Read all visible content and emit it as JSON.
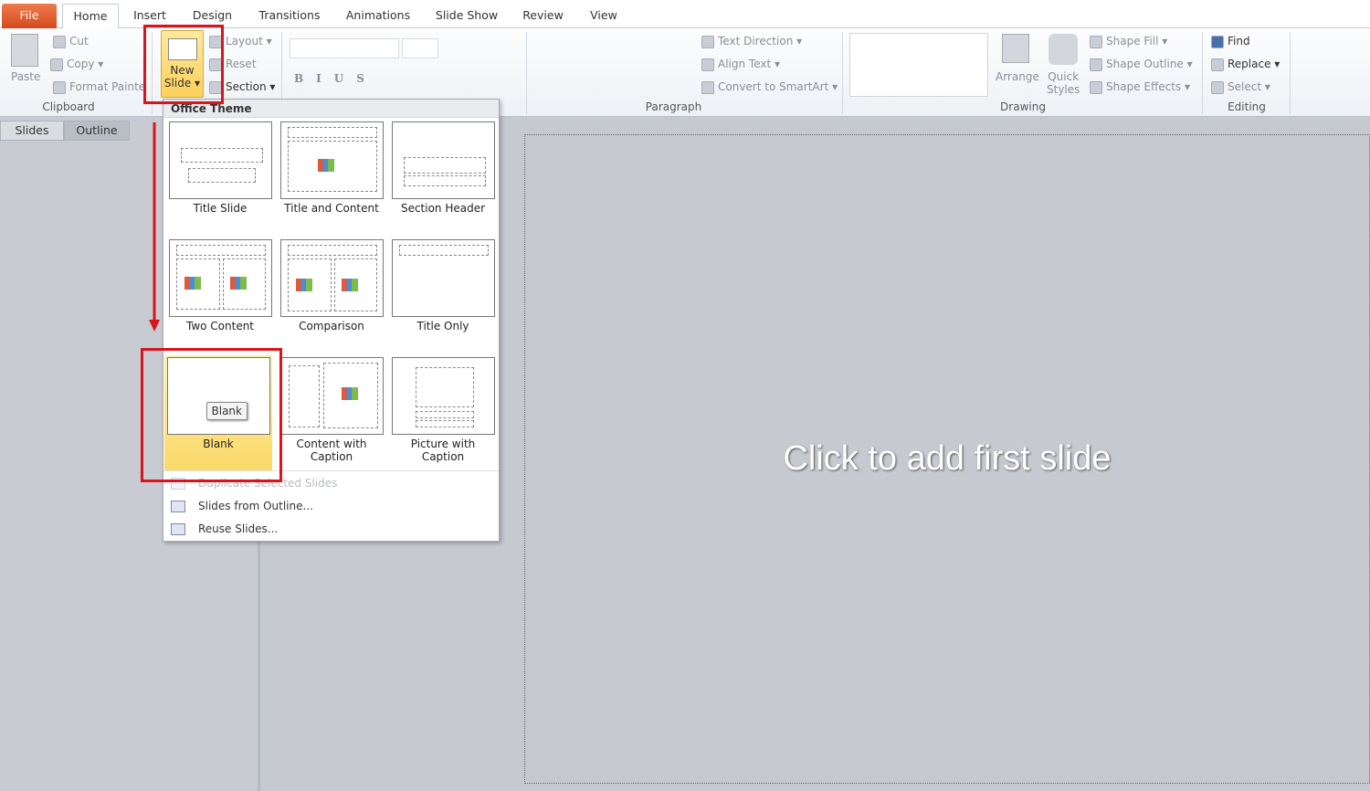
{
  "tabs": [
    {
      "label": "File"
    },
    {
      "label": "Home"
    },
    {
      "label": "Insert"
    },
    {
      "label": "Design"
    },
    {
      "label": "Transitions"
    },
    {
      "label": "Animations"
    },
    {
      "label": "Slide Show"
    },
    {
      "label": "Review"
    },
    {
      "label": "View"
    }
  ],
  "clipboard": {
    "paste": "Paste",
    "cut": "Cut",
    "copy": "Copy",
    "format_painter": "Format Painter",
    "label": "Clipboard"
  },
  "slides": {
    "new_slide_line1": "New",
    "new_slide_line2": "Slide",
    "layout": "Layout",
    "reset": "Reset",
    "section": "Section"
  },
  "paragraph": {
    "text_direction": "Text Direction",
    "align_text": "Align Text",
    "convert_smartart": "Convert to SmartArt",
    "label": "Paragraph"
  },
  "drawing": {
    "arrange": "Arrange",
    "quick_styles_1": "Quick",
    "quick_styles_2": "Styles",
    "shape_fill": "Shape Fill",
    "shape_outline": "Shape Outline",
    "shape_effects": "Shape Effects",
    "label": "Drawing"
  },
  "editing": {
    "find": "Find",
    "replace": "Replace",
    "select": "Select",
    "label": "Editing"
  },
  "panel_tabs": {
    "slides": "Slides",
    "outline": "Outline"
  },
  "slide_placeholder": "Click to add first slide",
  "dropdown": {
    "header": "Office Theme",
    "layouts": [
      {
        "label": "Title Slide"
      },
      {
        "label": "Title and Content"
      },
      {
        "label": "Section Header"
      },
      {
        "label": "Two Content"
      },
      {
        "label": "Comparison"
      },
      {
        "label": "Title Only"
      },
      {
        "label": "Blank"
      },
      {
        "label": "Content with Caption"
      },
      {
        "label": "Picture with Caption"
      }
    ],
    "tooltip": "Blank",
    "menu": [
      {
        "label": "Duplicate Selected Slides",
        "disabled": true
      },
      {
        "label": "Slides from Outline..."
      },
      {
        "label": "Reuse Slides..."
      }
    ]
  },
  "colors": {
    "annotation": "#d9141b",
    "file_tab": "#d44a1c",
    "selected": "#fbd96a"
  }
}
